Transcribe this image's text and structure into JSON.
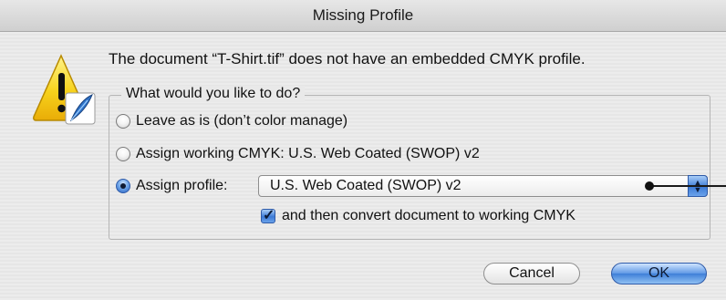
{
  "window": {
    "title": "Missing Profile"
  },
  "dialog": {
    "message": "The document “T-Shirt.tif” does not have an embedded CMYK profile.",
    "group_title": "What would you like to do?",
    "options": [
      {
        "label": "Leave as is (don’t color manage)",
        "selected": false
      },
      {
        "label": "Assign working CMYK:  U.S. Web Coated (SWOP) v2",
        "selected": false
      },
      {
        "label": "Assign profile:",
        "selected": true
      }
    ],
    "profile_popup": {
      "selected_value": "U.S. Web Coated (SWOP) v2"
    },
    "convert_checkbox": {
      "label": "and then convert document to working CMYK",
      "checked": true
    }
  },
  "buttons": {
    "cancel_label": "Cancel",
    "ok_label": "OK"
  },
  "icons": {
    "alert": "warning-triangle-icon",
    "badge": "feather-icon",
    "popup_arrows": "up-down-arrows-icon"
  },
  "colors": {
    "accent": "#3c7ad6",
    "warning": "#f4c419"
  }
}
